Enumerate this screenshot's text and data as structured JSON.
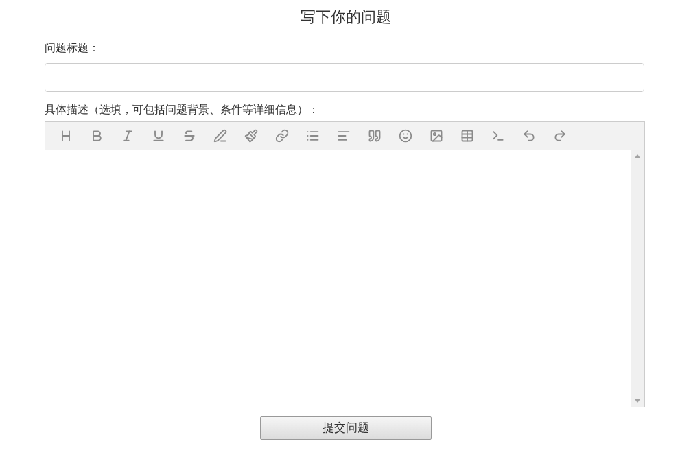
{
  "page_title": "写下你的问题",
  "title_field": {
    "label": "问题标题："
  },
  "description_field": {
    "label": "具体描述（选填，可包括问题背景、条件等详细信息）："
  },
  "submit_button": {
    "label": "提交问题"
  }
}
